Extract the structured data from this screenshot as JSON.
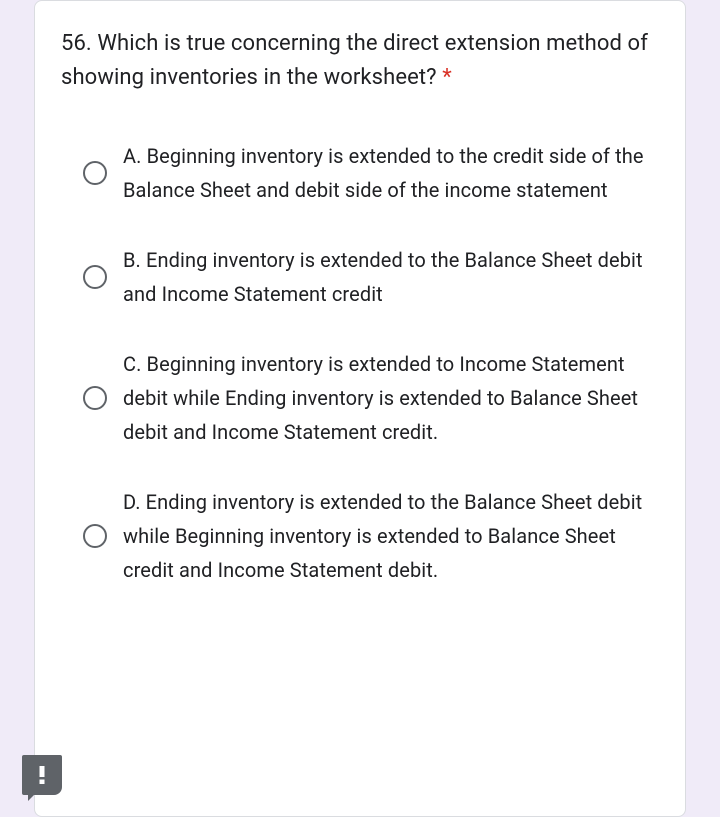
{
  "question": {
    "number_and_text": "56. Which is true concerning the direct extension method of showing inventories in the worksheet?",
    "required_marker": " *"
  },
  "options": [
    {
      "label": "A. Beginning inventory is extended to the credit side of the Balance Sheet and debit side of the income statement"
    },
    {
      "label": "B. Ending inventory is extended to the Balance Sheet debit and Income Statement credit"
    },
    {
      "label": "C. Beginning inventory is extended to Income Statement debit while Ending inventory is extended to Balance Sheet debit and Income Statement credit."
    },
    {
      "label": "D. Ending inventory is extended to the Balance Sheet debit while Beginning inventory is extended to Balance Sheet credit and Income Statement debit."
    }
  ],
  "fab": {
    "name": "report-problem"
  }
}
